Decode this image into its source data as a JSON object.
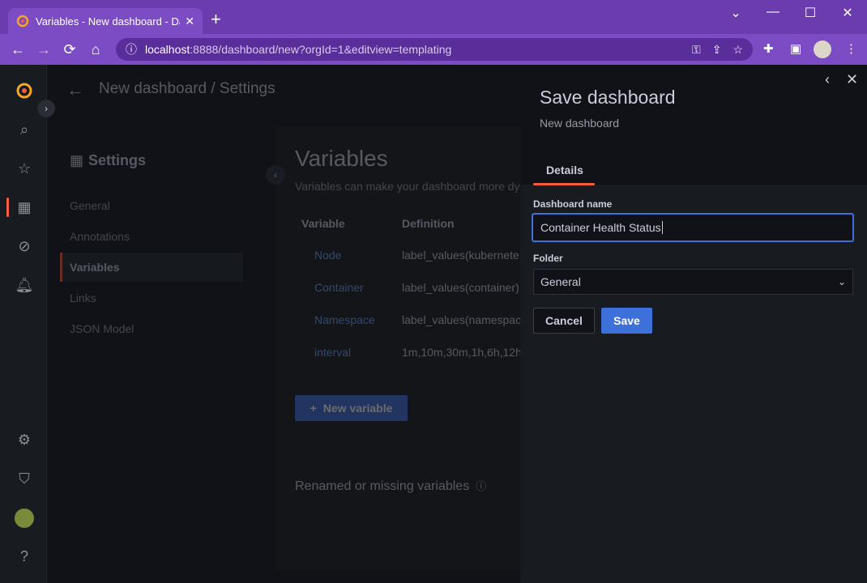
{
  "browser": {
    "tab_title": "Variables - New dashboard - Das",
    "url_host": "localhost",
    "url_path": ":8888/dashboard/new?orgId=1&editview=templating"
  },
  "header": {
    "breadcrumb": "New dashboard / Settings"
  },
  "settings": {
    "title": "Settings",
    "nav": [
      "General",
      "Annotations",
      "Variables",
      "Links",
      "JSON Model"
    ],
    "active": "Variables"
  },
  "variables": {
    "title": "Variables",
    "subtitle": "Variables can make your dashboard more dy",
    "col_variable": "Variable",
    "col_definition": "Definition",
    "rows": [
      {
        "name": "Node",
        "definition": "label_values(kubernete"
      },
      {
        "name": "Container",
        "definition": "label_values(container)"
      },
      {
        "name": "Namespace",
        "definition": "label_values(namespac"
      },
      {
        "name": "interval",
        "definition": "1m,10m,30m,1h,6h,12h"
      }
    ],
    "new_button": "New variable",
    "renamed_title": "Renamed or missing variables"
  },
  "drawer": {
    "title": "Save dashboard",
    "subtitle": "New dashboard",
    "tab": "Details",
    "name_label": "Dashboard name",
    "name_value": "Container Health Status",
    "folder_label": "Folder",
    "folder_value": "General",
    "cancel_label": "Cancel",
    "save_label": "Save"
  },
  "colors": {
    "accent": "#f55f3e",
    "primary": "#3d71d9",
    "browser": "#6a3cae"
  }
}
